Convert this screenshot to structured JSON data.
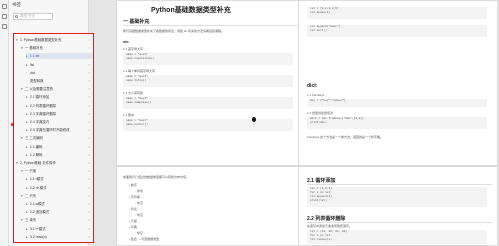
{
  "sidebar": {
    "header": "书签",
    "search_placeholder": "查找书签",
    "items": [
      {
        "label": "1. Python基础数据类型补充",
        "level": 0,
        "state": "expanded"
      },
      {
        "label": "一 基础补充",
        "level": 1,
        "state": "expanded"
      },
      {
        "label": "1.1 str",
        "level": 2,
        "state": "collapsed"
      },
      {
        "label": "list",
        "level": 2,
        "state": "collapsed"
      },
      {
        "label": "dict",
        "level": 2,
        "state": "leaf"
      },
      {
        "label": "类型转换",
        "level": 2,
        "state": "leaf"
      },
      {
        "label": "二 以及需要注意的",
        "level": 1,
        "state": "expanded"
      },
      {
        "label": "2.1 循环添加",
        "level": 2,
        "state": "collapsed"
      },
      {
        "label": "2.2 列表循环删除",
        "level": 2,
        "state": "collapsed"
      },
      {
        "label": "2.3 字典循环删除",
        "level": 2,
        "state": "collapsed"
      },
      {
        "label": "2.4 字典技巧",
        "level": 2,
        "state": "collapsed"
      },
      {
        "label": "2.5 字典在循环时不能修改",
        "level": 2,
        "state": "collapsed"
      },
      {
        "label": "三 二次编码",
        "level": 1,
        "state": "expanded"
      },
      {
        "label": "1.1 编码",
        "level": 2,
        "state": "collapsed"
      },
      {
        "label": "1.2 解码",
        "level": 2,
        "state": "collapsed"
      },
      {
        "label": "2. Python基础-文件操作",
        "level": 0,
        "state": "expanded"
      },
      {
        "label": "一 只读",
        "level": 1,
        "state": "expanded"
      },
      {
        "label": "1.1 r模式",
        "level": 2,
        "state": "collapsed"
      },
      {
        "label": "1.2 rb 模式",
        "level": 2,
        "state": "collapsed"
      },
      {
        "label": "二 只写",
        "level": 1,
        "state": "expanded"
      },
      {
        "label": "2.1 w模式",
        "level": 2,
        "state": "collapsed"
      },
      {
        "label": "2.2 追加模式",
        "level": 2,
        "state": "collapsed"
      },
      {
        "label": "三 读写",
        "level": 1,
        "state": "expanded"
      },
      {
        "label": "3.1 r+模式",
        "level": 2,
        "state": "collapsed"
      },
      {
        "label": "3.2 read(n)",
        "level": 2,
        "state": "collapsed"
      }
    ],
    "active_index": 2,
    "page_numbers": [
      "1",
      "1",
      "1",
      "2",
      "2",
      "3",
      "3",
      "3",
      "3",
      "3",
      "4",
      "4",
      "4",
      "4",
      "4",
      "5",
      "5",
      "5",
      "5",
      "5",
      "5",
      "5",
      "6",
      "6",
      "6"
    ]
  },
  "page1": {
    "title": "Python基础数据类型补充",
    "section": "一 基础补充",
    "intro": "我们基础数据类型补充了各数据的用法，例如 str 有关的方法请看后续课程。",
    "str_head": "str:",
    "str_item1": "1.1 首字母大写",
    "str_item2": "1.2 每个单词首字母大写",
    "str_item3": "1.3 大小写转换",
    "str_item4": "1.4 居中",
    "code_lines": [
      "name = \"meet\"",
      "name.capitalize()",
      "name = \"meet\"",
      "name.title()",
      "name = \"meet\"",
      "name.swapcase()",
      "name = \"meet\"",
      "name.center()"
    ]
  },
  "page2": {
    "dict_head": "dict:",
    "item1": "1.1 fromkeys",
    "item2": "1.2 批量创建键值对",
    "note": "fromkeys 这个方法是一个类方法，返回的是一个新字典。",
    "code_lines": [
      "lst = [1,2,3,4,5]",
      "lst.index(1)",
      "lst.append(\"meet\")",
      "lst.sort()",
      "dic = {\"key\":\"value\"}",
      "dic1 = dic.fromkeys(\"abc\",[1,2])",
      "print(dic)"
    ]
  },
  "page3": {
    "intro": "前面我们介绍过的数据类型都可以转换为布尔值。",
    "bullets": [
      "数字",
      "字符串",
      "列表",
      "元组",
      "字典",
      "集合",
      "可变数据类型"
    ],
    "sub": [
      "非零",
      "非空",
      "非空",
      "非空"
    ]
  },
  "page4": {
    "h1": "2.1 循环添加",
    "h2": "2.2 列表循环删除",
    "note": "在循环中添加元素会导致死循环。",
    "code_lines": [
      "lst = [1,2,3]",
      "for i in lst:",
      "    lst.append(4)",
      "print(lst)",
      "lst = [11, 22, 33, 44]",
      "for i in lst:",
      "    lst.remove(i)"
    ]
  }
}
